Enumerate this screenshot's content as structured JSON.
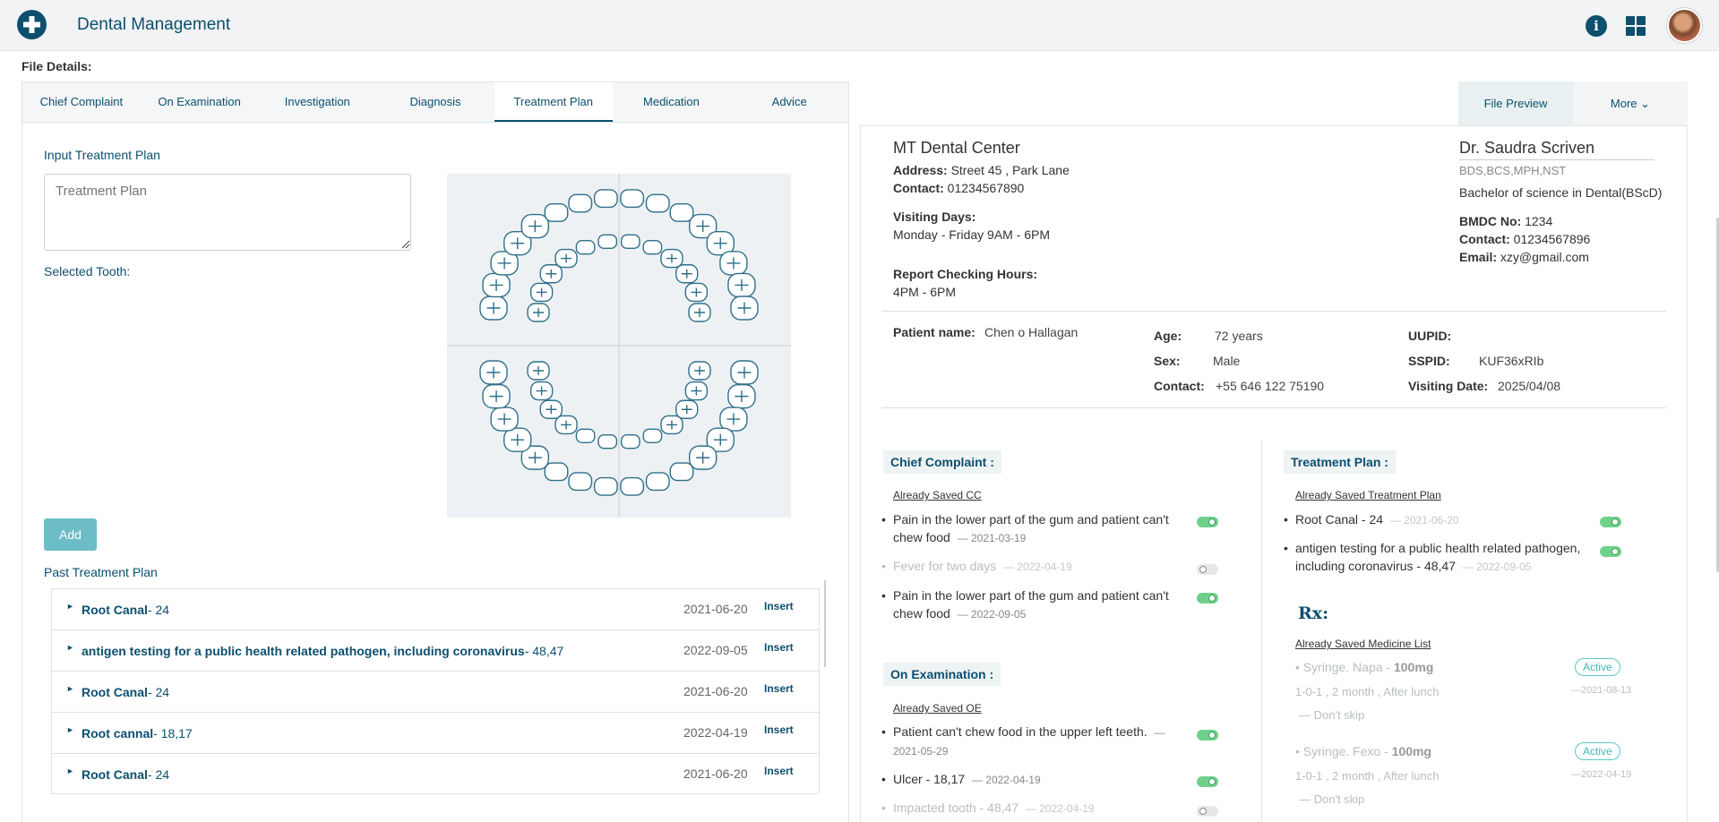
{
  "header": {
    "app_title": "Dental Management",
    "logo_icon": "plus-cross-icon",
    "info_icon": "info-icon",
    "apps_icon": "grid-icon",
    "avatar": "user-avatar"
  },
  "file_details_label": "File Details:",
  "tabs": [
    {
      "label": "Chief Complaint",
      "active": false
    },
    {
      "label": "On Examination",
      "active": false
    },
    {
      "label": "Investigation",
      "active": false
    },
    {
      "label": "Diagnosis",
      "active": false
    },
    {
      "label": "Treatment Plan",
      "active": true
    },
    {
      "label": "Medication",
      "active": false
    },
    {
      "label": "Advice",
      "active": false
    }
  ],
  "treatment_form": {
    "input_label": "Input Treatment Plan",
    "input_placeholder": "Treatment Plan",
    "selected_tooth_label": "Selected Tooth:",
    "add_button": "Add"
  },
  "past_treatment": {
    "title": "Past Treatment Plan",
    "insert_label": "Insert",
    "rows": [
      {
        "name": "Root Canal",
        "teeth": "- 24",
        "date": "2021-06-20"
      },
      {
        "name": "antigen testing for a public health related pathogen, including coronavirus",
        "teeth": "- 48,47",
        "date": "2022-09-05"
      },
      {
        "name": "Root Canal",
        "teeth": "- 24",
        "date": "2021-06-20"
      },
      {
        "name": "Root cannal",
        "teeth": "- 18,17",
        "date": "2022-04-19"
      },
      {
        "name": "Root Canal",
        "teeth": "- 24",
        "date": "2021-06-20"
      }
    ]
  },
  "preview_tabs": {
    "file_preview": "File Preview",
    "more": "More"
  },
  "clinic": {
    "name": "MT Dental Center",
    "address_label": "Address:",
    "address": "Street 45 , Park Lane",
    "contact_label": "Contact:",
    "contact": "01234567890",
    "visiting_days_label": "Visiting Days:",
    "visiting_days": "Monday - Friday 9AM - 6PM",
    "report_hours_label": "Report Checking Hours:",
    "report_hours": "4PM - 6PM"
  },
  "doctor": {
    "name": "Dr. Saudra Scriven",
    "degrees": "BDS,BCS,MPH,NST",
    "degree_full": "Bachelor of science in Dental(BScD)",
    "bmdc_label": "BMDC No:",
    "bmdc": "1234",
    "contact_label": "Contact:",
    "contact": "01234567896",
    "email_label": "Email:",
    "email": "xzy@gmail.com"
  },
  "patient": {
    "name_label": "Patient name:",
    "name": "Chen o Hallagan",
    "age_label": "Age:",
    "age": "72 years",
    "sex_label": "Sex:",
    "sex": "Male",
    "contact_label": "Contact:",
    "contact": "+55 646 122 75190",
    "uupid_label": "UUPID:",
    "uupid": "",
    "sspid_label": "SSPID:",
    "sspid": "KUF36xRIb",
    "visiting_date_label": "Visiting Date:",
    "visiting_date": "2025/04/08"
  },
  "chief_complaint": {
    "title": "Chief Complaint :",
    "subtitle": "Already Saved CC",
    "items": [
      {
        "line1": "Pain in the lower part of the gum and patient can't",
        "line2": "chew food",
        "date": "— 2021-03-19",
        "on": true
      },
      {
        "line1": "Fever for two days",
        "line2": "",
        "date": "— 2022-04-19",
        "on": false
      },
      {
        "line1": "Pain in the lower part of the gum and patient can't",
        "line2": "chew food",
        "date": "— 2022-09-05",
        "on": true
      }
    ]
  },
  "on_examination": {
    "title": "On Examination :",
    "subtitle": "Already Saved OE",
    "items": [
      {
        "line1": "Patient can't chew food in the upper left teeth.",
        "dash": "—",
        "date": "2021-05-29",
        "on": true
      },
      {
        "line1": "Ulcer - 18,17",
        "date": "— 2022-04-19",
        "on": true
      },
      {
        "line1": "Impacted tooth - 48,47",
        "date": "— 2022-04-19",
        "on": false
      }
    ]
  },
  "treatment_plan_preview": {
    "title": "Treatment Plan :",
    "subtitle": "Already Saved Treatment Plan",
    "items": [
      {
        "line1": "Root Canal - 24",
        "date": "— 2021-06-20",
        "on": true
      },
      {
        "line1": "antigen testing for a public health related pathogen,",
        "line2": "including coronavirus - 48,47",
        "date": "— 2022-09-05",
        "on": true
      }
    ]
  },
  "rx": {
    "title": "Rx:",
    "subtitle": "Already Saved Medicine List",
    "items": [
      {
        "name": "Syringe. Napa -",
        "dose": "100mg",
        "status": "Active",
        "schedule": "1-0-1 , 2 month , After lunch",
        "date": "—2021-08-13",
        "note": "—  Don't skip"
      },
      {
        "name": "Syringe. Fexo -",
        "dose": "100mg",
        "status": "Active",
        "schedule": "1-0-1 , 2 month , After lunch",
        "date": "—2022-04-19",
        "note": "—  Don't skip"
      }
    ]
  },
  "colors": {
    "brand": "#0d4f6e",
    "toggle_on": "#6fd08a",
    "add_button": "#6cbdc6"
  }
}
